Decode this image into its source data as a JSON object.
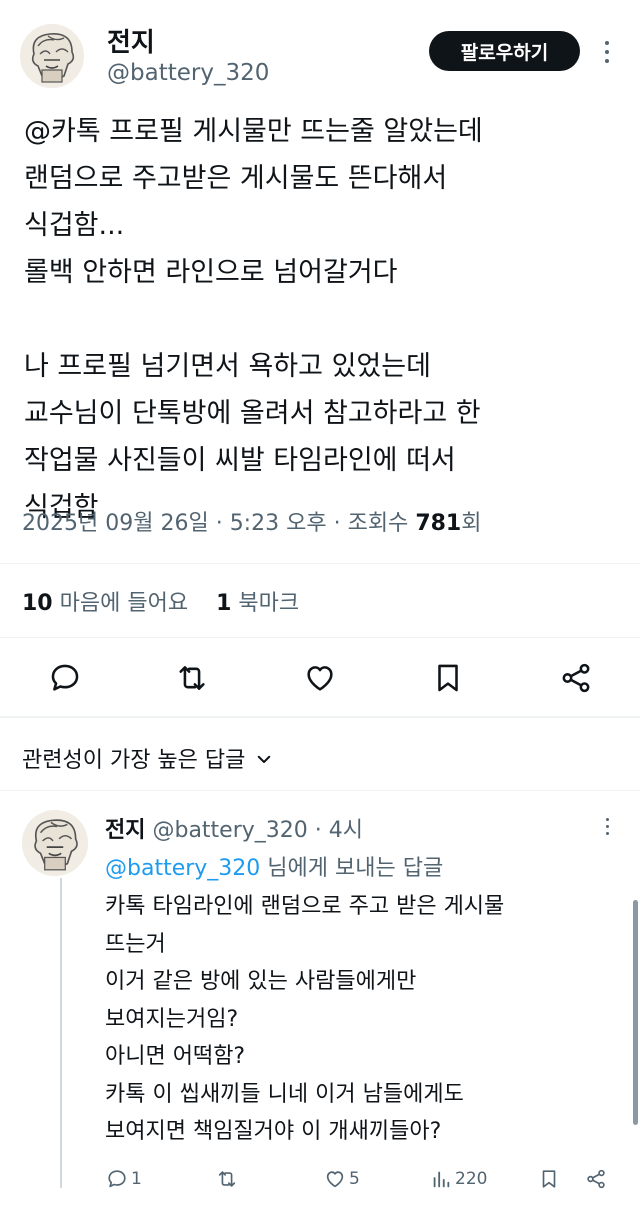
{
  "post": {
    "display_name": "전지",
    "handle": "@battery_320",
    "follow_label": "팔로우하기",
    "text_lines": [
      "@카톡 프로필 게시물만 뜨는줄 알았는데",
      "랜덤으로 주고받은 게시물도 뜬다해서",
      "식겁함...",
      "롤백 안하면 라인으로 넘어갈거다",
      "",
      "나 프로필 넘기면서 욕하고 있었는데",
      "교수님이 단톡방에 올려서 참고하라고 한",
      "작업물 사진들이 씨발 타임라인에 떠서",
      "식겁함"
    ],
    "date": "2025년 09월 26일",
    "time": "5:23 오후",
    "views_label": "조회수",
    "views_count": "781",
    "views_unit": "회",
    "likes_count": "10",
    "likes_label": "마음에 들어요",
    "bookmarks_count": "1",
    "bookmarks_label": "북마크"
  },
  "actions": [
    "reply-icon",
    "retweet-icon",
    "like-icon",
    "bookmark-icon",
    "share-icon"
  ],
  "sort_label": "관련성이 가장 높은 답글",
  "reply": {
    "display_name": "전지",
    "handle": "@battery_320",
    "time": "4시",
    "replying_handle": "@battery_320",
    "replying_suffix": "님에게 보내는 답글",
    "text_lines": [
      "카톡 타임라인에 랜덤으로 주고 받은 게시물",
      "뜨는거",
      "이거 같은 방에 있는 사람들에게만",
      "보여지는거임?",
      "아니면 어떡함?",
      "카톡 이 씹새끼들 니네 이거 남들에게도",
      "보여지면 책임질거야 이 개새끼들아?"
    ],
    "reply_count": "1",
    "retweet_count": "",
    "like_count": "5",
    "view_count": "220"
  },
  "colors": {
    "text": "#0f1419",
    "muted": "#536471",
    "link": "#1d9bf0",
    "button_bg": "#0f1419",
    "divider": "#eff3f4"
  }
}
